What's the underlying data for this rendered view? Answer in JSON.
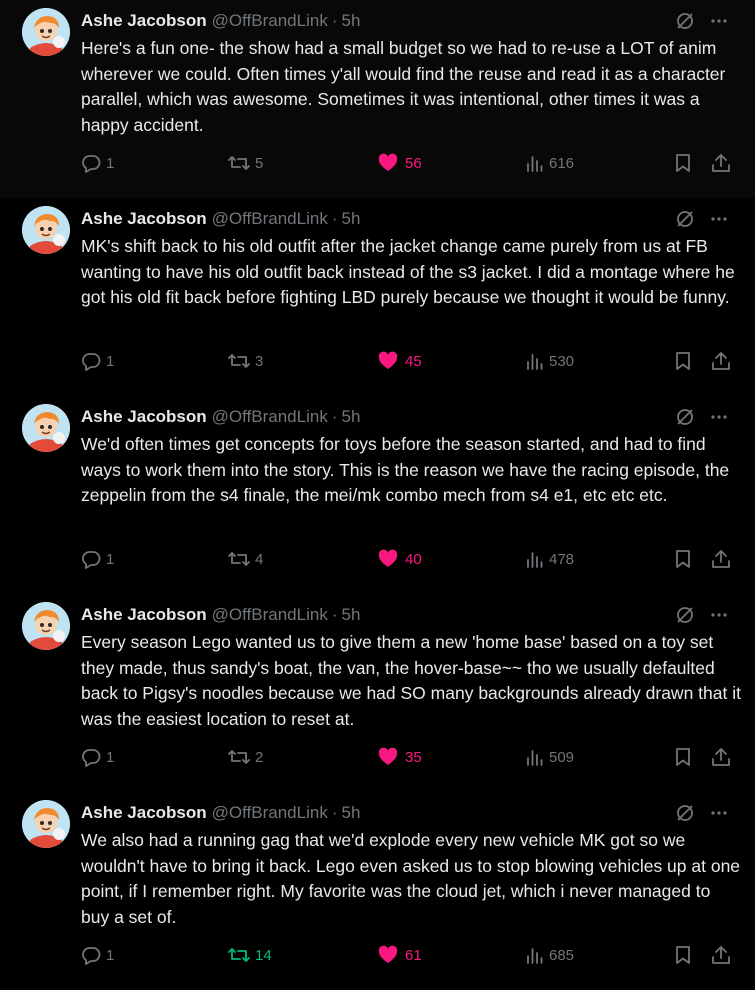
{
  "author": {
    "name": "Ashe Jacobson",
    "handle": "@OffBrandLink",
    "time": "5h"
  },
  "icons": {
    "grok": "slashed-circle-icon",
    "more": "more-icon",
    "reply": "reply-icon",
    "repost": "repost-icon",
    "like": "heart-icon",
    "views": "views-icon",
    "bookmark": "bookmark-icon",
    "share": "share-icon"
  },
  "colors": {
    "like": "#f91880",
    "repost_active": "#00ba7c",
    "muted": "#71767b"
  },
  "separator": "·",
  "tweets": [
    {
      "text": "Here's a fun one- the show had a small budget so we had to re-use a LOT of anim wherever we could. Often times y'all would find the reuse and read it as a character parallel, which was awesome. Sometimes it was intentional, other times it was a happy accident.",
      "replies": "1",
      "reposts": "5",
      "likes": "56",
      "views": "616",
      "reposted": false
    },
    {
      "text": "MK's shift back to his old outfit after the jacket change came purely from us at FB wanting to have his old outfit back instead of the s3 jacket. I did a montage where he got his old fit back before fighting LBD purely because we thought it would be funny.",
      "replies": "1",
      "reposts": "3",
      "likes": "45",
      "views": "530",
      "reposted": false
    },
    {
      "text": "We'd often times get concepts for toys before the season started, and had to find ways to work them into the story. This is the reason we have the racing episode, the zeppelin from the s4 finale, the mei/mk combo mech from s4 e1, etc etc etc.",
      "replies": "1",
      "reposts": "4",
      "likes": "40",
      "views": "478",
      "reposted": false
    },
    {
      "text": "Every season Lego wanted us to give them a new 'home base' based on a toy set they made, thus sandy's boat, the van, the hover-base~~ tho we usually defaulted back to Pigsy's noodles because we had SO many backgrounds already drawn that it was the easiest location to reset at.",
      "replies": "1",
      "reposts": "2",
      "likes": "35",
      "views": "509",
      "reposted": false
    },
    {
      "text": "We also had a running gag that we'd explode every new vehicle MK got so we wouldn't have to bring it back. Lego even asked us to stop blowing vehicles up at one point, if I remember right. My favorite was the cloud jet, which i never managed to buy a set of.",
      "replies": "1",
      "reposts": "14",
      "likes": "61",
      "views": "685",
      "reposted": true
    }
  ]
}
